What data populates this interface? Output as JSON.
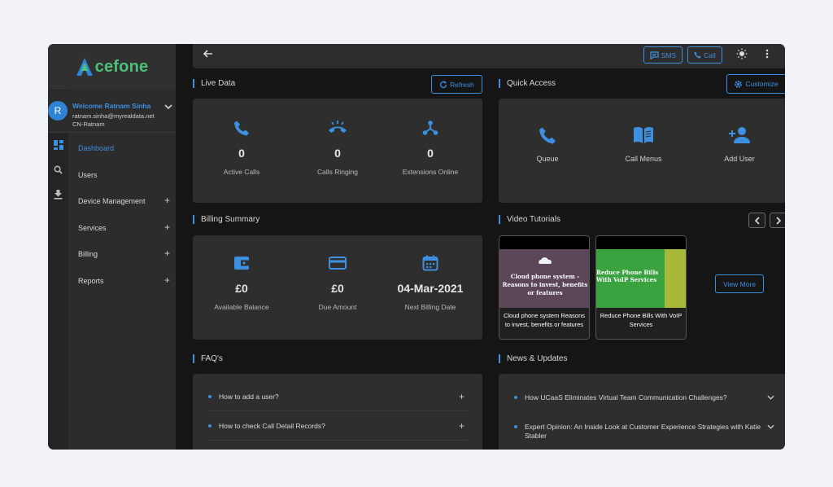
{
  "brand": {
    "logo_text": "cefone",
    "accent": "#3d8fe0",
    "logo_green": "#4cc17a"
  },
  "user": {
    "avatar_initial": "R",
    "welcome": "Welcome Ratnam Sinha",
    "email": "ratnam.sinha@myrealdata.net",
    "account": "CN-Ratnam"
  },
  "nav": [
    {
      "label": "Dashboard",
      "active": true
    },
    {
      "label": "Users"
    },
    {
      "label": "Device Management",
      "expandable": true
    },
    {
      "label": "Services",
      "expandable": true
    },
    {
      "label": "Billing",
      "expandable": true
    },
    {
      "label": "Reports",
      "expandable": true
    }
  ],
  "topbar": {
    "sms_label": "SMS",
    "call_label": "Call"
  },
  "live_data": {
    "title": "Live Data",
    "refresh_label": "Refresh",
    "stats": [
      {
        "value": "0",
        "label": "Active Calls",
        "icon": "phone-icon"
      },
      {
        "value": "0",
        "label": "Calls Ringing",
        "icon": "ringing-phone-icon"
      },
      {
        "value": "0",
        "label": "Extensions Online",
        "icon": "network-icon"
      }
    ]
  },
  "quick_access": {
    "title": "Quick Access",
    "customize_label": "Customize",
    "items": [
      {
        "label": "Queue",
        "icon": "phone-icon"
      },
      {
        "label": "Call Menus",
        "icon": "book-icon"
      },
      {
        "label": "Add User",
        "icon": "add-user-icon"
      }
    ]
  },
  "billing": {
    "title": "Billing Summary",
    "stats": [
      {
        "value": "£0",
        "label": "Available Balance",
        "icon": "wallet-icon"
      },
      {
        "value": "£0",
        "label": "Due Amount",
        "icon": "card-icon"
      },
      {
        "value": "04-Mar-2021",
        "label": "Next Billing Date",
        "icon": "calendar-icon"
      }
    ]
  },
  "videos": {
    "title": "Video Tutorials",
    "view_more_label": "View More",
    "items": [
      {
        "thumb_text": "Cloud phone system - Reasons to invest, benefits or features",
        "caption": "Cloud phone system Reasons to invest, benefits or features"
      },
      {
        "thumb_text": "Reduce Phone Bills With VoIP Services",
        "caption": "Reduce Phone Bills With VoIP Services"
      }
    ]
  },
  "faqs": {
    "title": "FAQ's",
    "items": [
      {
        "question": "How to add a user?"
      },
      {
        "question": "How to check Call Detail Records?"
      }
    ]
  },
  "news": {
    "title": "News & Updates",
    "items": [
      {
        "headline": "How UCaaS Eliminates Virtual Team Communication Challenges?"
      },
      {
        "headline": "Expert Opinion: An Inside Look at Customer Experience Strategies with Katie Stabler"
      }
    ]
  }
}
